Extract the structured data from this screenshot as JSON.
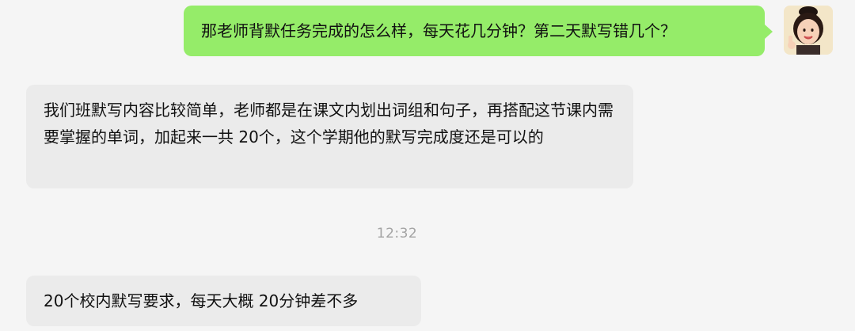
{
  "messages": {
    "outgoing_1": "那老师背默任务完成的怎么样，每天花几分钟？第二天默写错几个？",
    "incoming_1": "我们班默写内容比较简单，老师都是在课文内划出词组和句子，再搭配这节课内需要掌握的单词，加起来一共 20个，这个学期他的默写完成度还是可以的",
    "incoming_2": "20个校内默写要求，每天大概 20分钟差不多"
  },
  "timestamp": "12:32",
  "colors": {
    "outgoing_bubble": "#95ec69",
    "incoming_bubble": "#ebebeb",
    "background": "#f5f5f5",
    "timestamp_text": "#a3a3a3"
  },
  "icons": {
    "avatar": "child-avatar-photo"
  }
}
